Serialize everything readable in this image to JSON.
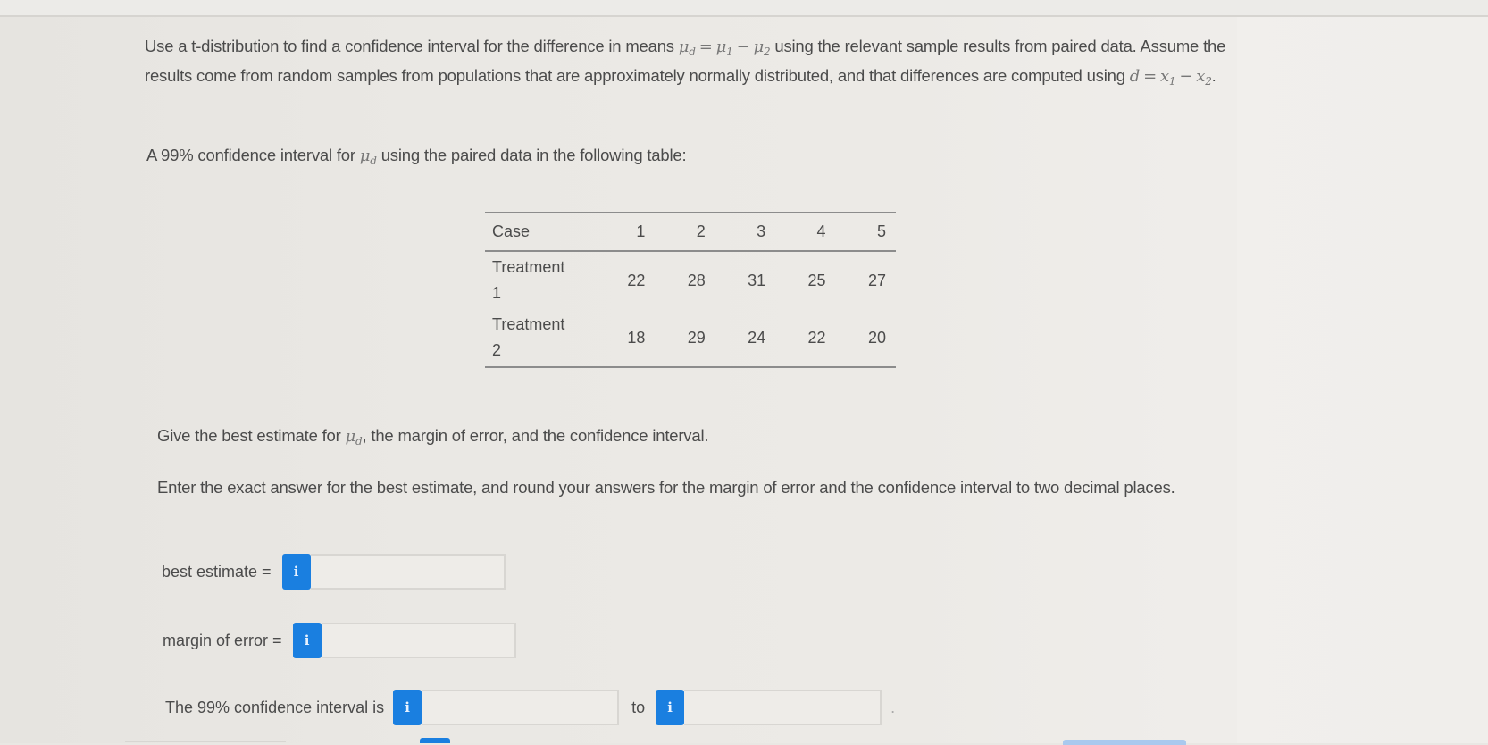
{
  "problem": {
    "intro_part1": "Use a t-distribution to find a confidence interval for the difference in means ",
    "intro_part2": " using the relevant sample results from paired data. Assume the results come from random samples from populations that are approximately normally distributed, and that differences are computed using ",
    "intro_part3": ".",
    "mu": "μ",
    "sub_d": "d",
    "sub_1": "1",
    "sub_2": "2",
    "eq": "=",
    "minus": "−",
    "d_var": "d",
    "x_var": "x",
    "prompt_part1": "A 99% confidence interval for ",
    "prompt_part2": " using the paired data in the following table:",
    "give_part1": "Give the best estimate for ",
    "give_part2": ", the margin of error, and the confidence interval.",
    "enter_instructions": "Enter the exact answer for the best estimate, and round your answers for the margin of error and the confidence interval to two decimal places."
  },
  "table": {
    "header_label": "Case",
    "cases": [
      "1",
      "2",
      "3",
      "4",
      "5"
    ],
    "rows": [
      {
        "label_line1": "Treatment",
        "label_line2": "1",
        "values": [
          "22",
          "28",
          "31",
          "25",
          "27"
        ]
      },
      {
        "label_line1": "Treatment",
        "label_line2": "2",
        "values": [
          "18",
          "29",
          "24",
          "22",
          "20"
        ]
      }
    ]
  },
  "answers": {
    "best_estimate_label": "best estimate =",
    "best_estimate_value": "",
    "margin_of_error_label": "margin of error =",
    "margin_of_error_value": "",
    "ci_label": "The 99% confidence interval is",
    "ci_lower_value": "",
    "ci_to": "to",
    "ci_upper_value": "",
    "ci_period": ".",
    "info_glyph": "i"
  },
  "colors": {
    "accent": "#1a7fe0",
    "text": "#4b4b4b",
    "background": "#e9e7e3"
  }
}
